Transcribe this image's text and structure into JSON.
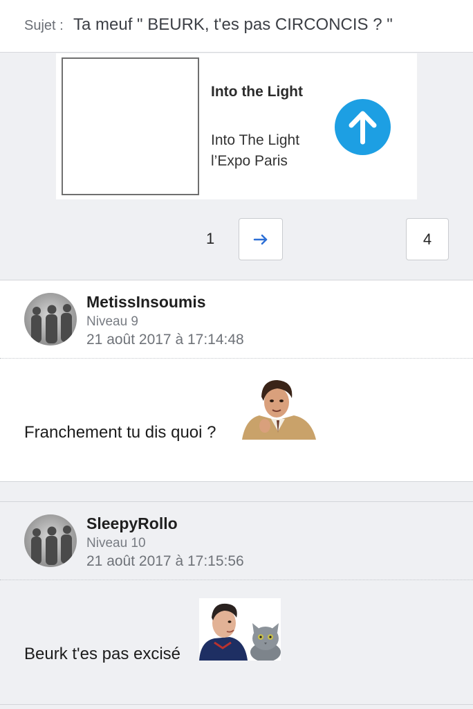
{
  "topic": {
    "subject_prefix": "Sujet :",
    "subject_title": "Ta meuf \" BEURK, t'es pas CIRCONCIS ? \""
  },
  "ad": {
    "title": "Into the Light",
    "line1": "Into The Light",
    "line2": "l’Expo Paris",
    "arrow_icon": "arrow-up-icon",
    "arrow_color": "#1d9fe3"
  },
  "pagination": {
    "current_page": "1",
    "next_icon": "arrow-right-icon",
    "last_page": "4"
  },
  "posts": [
    {
      "username": "MetissInsoumis",
      "level": "Niveau 9",
      "date": "21 août 2017 à 17:14:48",
      "message": "Franchement tu dis quoi ?",
      "sticker": "man-in-tan-jacket-sticker"
    },
    {
      "username": "SleepyRollo",
      "level": "Niveau 10",
      "date": "21 août 2017 à 17:15:56",
      "message": "Beurk t'es pas excisé",
      "sticker": "man-and-grey-cat-sticker"
    }
  ]
}
